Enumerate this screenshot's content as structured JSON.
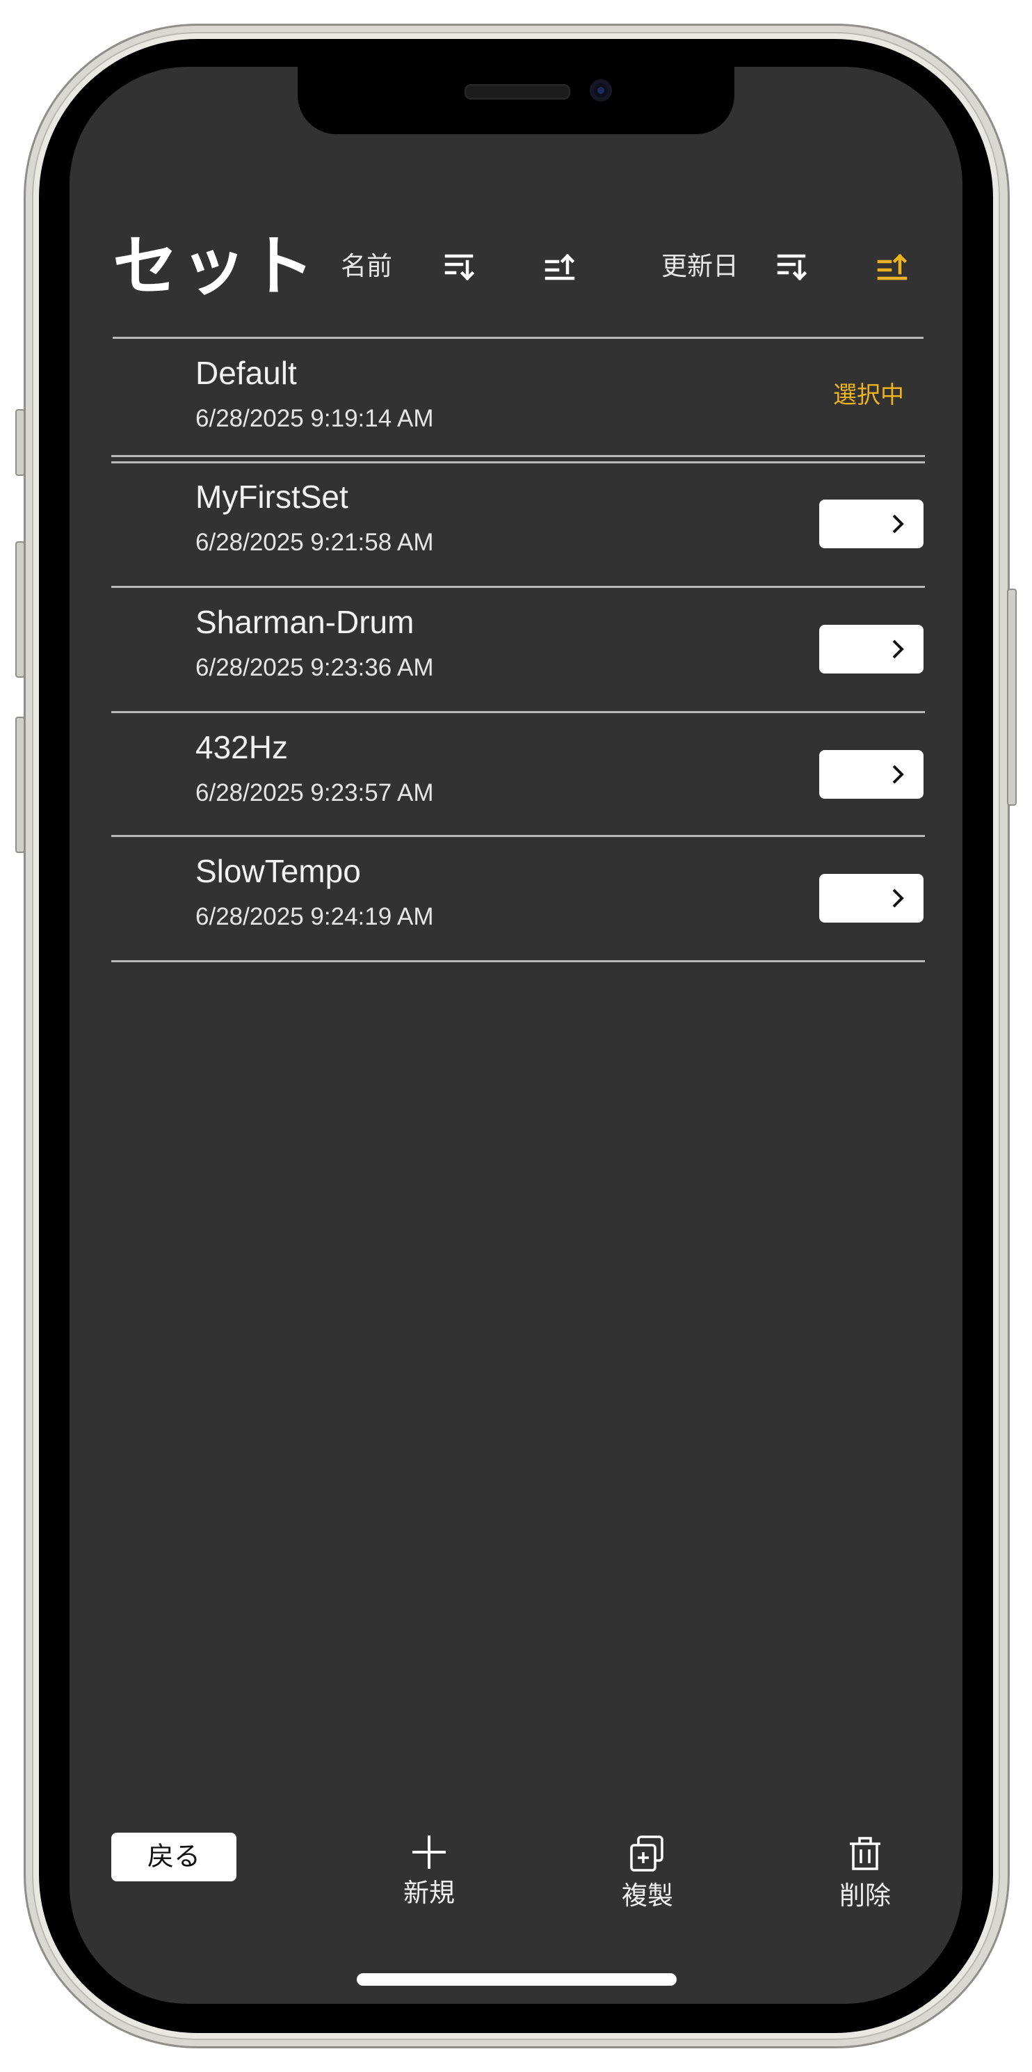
{
  "header": {
    "title": "セット",
    "sort_name_label": "名前",
    "sort_date_label": "更新日"
  },
  "colors": {
    "background": "#323232",
    "accent": "#f0b320",
    "text": "#f2f2f2",
    "divider": "#b9b9b9"
  },
  "sets": [
    {
      "name": "Default",
      "date": "6/28/2025 9:19:14 AM",
      "status": "選択中"
    },
    {
      "name": "MyFirstSet",
      "date": "6/28/2025 9:21:58 AM"
    },
    {
      "name": "Sharman-Drum",
      "date": "6/28/2025 9:23:36 AM"
    },
    {
      "name": "432Hz",
      "date": "6/28/2025 9:23:57 AM"
    },
    {
      "name": "SlowTempo",
      "date": "6/28/2025 9:24:19 AM"
    }
  ],
  "toolbar": {
    "back_label": "戻る",
    "new_label": "新規",
    "duplicate_label": "複製",
    "delete_label": "削除"
  },
  "icons": {
    "sort_desc": "sort-descending-icon",
    "sort_asc": "sort-ascending-icon",
    "row_open": "chevron-right-icon",
    "new": "plus-icon",
    "duplicate": "duplicate-icon",
    "delete": "trash-icon"
  }
}
